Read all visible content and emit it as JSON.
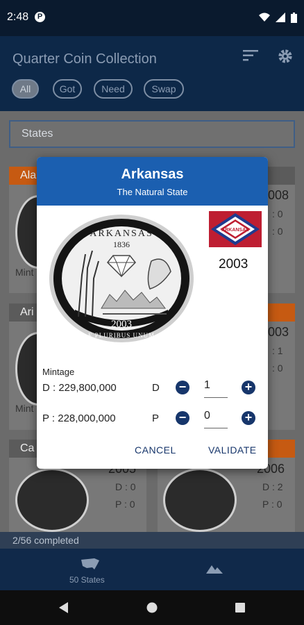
{
  "status_bar": {
    "time": "2:48",
    "app_icon_letter": "P"
  },
  "app": {
    "title": "Quarter Coin Collection",
    "filters": [
      "All",
      "Got",
      "Need",
      "Swap"
    ],
    "selected_filter": "All",
    "search_value": "States"
  },
  "background_cards": [
    {
      "header": "Ala",
      "header_color": "#c65a12",
      "label": "Mint"
    },
    {
      "header": "Ari",
      "header_color": "#5b5b5b",
      "label": "Mint"
    },
    {
      "header": "Ca",
      "header_color": "#5b5b5b",
      "year": "2005",
      "d": "D : 0",
      "p": "P : 0"
    }
  ],
  "right_cards": [
    {
      "year": "008",
      "d": ": 0",
      "p": ": 0"
    },
    {
      "year": "003",
      "d": ": 1",
      "p": ": 0"
    },
    {
      "year": "2006",
      "d": "D : 2",
      "p": "P : 0"
    }
  ],
  "progress_text": "2/56 completed",
  "bottom_nav": {
    "states_label": "50 States"
  },
  "dialog": {
    "state": "Arkansas",
    "nickname": "The Natural State",
    "year": "2003",
    "flag_text": "ARKANSAS",
    "coin_text": {
      "top": "ARKANSAS",
      "founded": "1836",
      "year": "2003",
      "motto": "E PLURIBUS UNUM"
    },
    "mintage_title": "Mintage",
    "rows": [
      {
        "mintage": "D : 229,800,000",
        "mark": "D",
        "qty": "1"
      },
      {
        "mintage": "P : 228,000,000",
        "mark": "P",
        "qty": "0"
      }
    ],
    "cancel_label": "CANCEL",
    "validate_label": "VALIDATE"
  },
  "colors": {
    "dialog_header": "#1b5fb0",
    "accent": "#17366b",
    "flag_red": "#be1e32",
    "flag_blue": "#1f3a8f"
  }
}
